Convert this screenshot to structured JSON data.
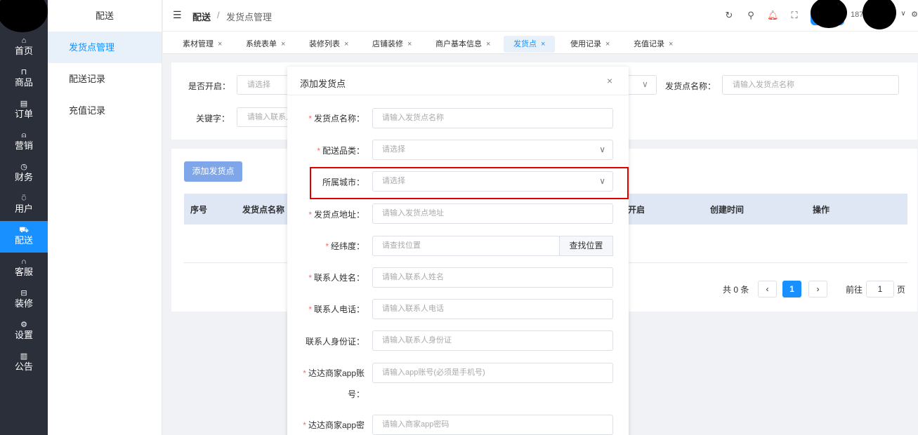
{
  "nav": {
    "items": [
      {
        "label": "首页",
        "icon": "home-icon",
        "glyph": "⌂"
      },
      {
        "label": "商品",
        "icon": "bag-icon",
        "glyph": "⊓"
      },
      {
        "label": "订单",
        "icon": "order-icon",
        "glyph": "▤"
      },
      {
        "label": "营销",
        "icon": "bell-icon",
        "glyph": "⍝"
      },
      {
        "label": "财务",
        "icon": "clock-icon",
        "glyph": "◷"
      },
      {
        "label": "用户",
        "icon": "user-icon",
        "glyph": "⍥"
      },
      {
        "label": "配送",
        "icon": "truck-icon",
        "glyph": "⛟"
      },
      {
        "label": "客服",
        "icon": "headset-icon",
        "glyph": "∩"
      },
      {
        "label": "装修",
        "icon": "brush-icon",
        "glyph": "⊟"
      },
      {
        "label": "设置",
        "icon": "gear-icon",
        "glyph": "⚙"
      },
      {
        "label": "公告",
        "icon": "notice-icon",
        "glyph": "▥"
      }
    ],
    "active_index": 6
  },
  "subnav": {
    "title": "配送",
    "items": [
      "发货点管理",
      "配送记录",
      "充值记录"
    ]
  },
  "header": {
    "breadcrumb_root": "配送",
    "breadcrumb_sep": "/",
    "breadcrumb_current": "发货点管理",
    "username": "187"
  },
  "tabs": [
    {
      "label": "素材管理"
    },
    {
      "label": "系统表单"
    },
    {
      "label": "装修列表"
    },
    {
      "label": "店铺装修"
    },
    {
      "label": "商户基本信息"
    },
    {
      "label": "发货点"
    },
    {
      "label": "使用记录"
    },
    {
      "label": "充值记录"
    }
  ],
  "filters": {
    "enabled_label": "是否开启：",
    "enabled_placeholder": "请选择",
    "name_label": "发货点名称：",
    "name_placeholder": "请输入发货点名称",
    "keyword_label": "关键字：",
    "keyword_placeholder": "请输入联系人"
  },
  "table": {
    "add_button": "添加发货点",
    "columns": [
      "序号",
      "发货点名称",
      "开启",
      "创建时间",
      "操作"
    ]
  },
  "pagination": {
    "total_text": "共 0 条",
    "current_page": "1",
    "goto_label": "前往",
    "goto_value": "1",
    "page_suffix": "页"
  },
  "dialog": {
    "title": "添加发货点",
    "fields": [
      {
        "label": "发货点名称：",
        "required": true,
        "placeholder": "请输入发货点名称"
      },
      {
        "label": "配送品类：",
        "required": true,
        "placeholder": "请选择",
        "select": true
      },
      {
        "label": "所属城市：",
        "required": false,
        "placeholder": "请选择",
        "select": true
      },
      {
        "label": "发货点地址：",
        "required": true,
        "placeholder": "请输入发货点地址"
      },
      {
        "label": "经纬度：",
        "required": true,
        "placeholder": "请查找位置"
      },
      {
        "label": "联系人姓名：",
        "required": true,
        "placeholder": "请输入联系人姓名"
      },
      {
        "label": "联系人电话：",
        "required": true,
        "placeholder": "请输入联系人电话"
      },
      {
        "label": "联系人身份证：",
        "required": false,
        "placeholder": "请输入联系人身份证"
      },
      {
        "label": "达达商家app账",
        "label2": "号：",
        "required": true,
        "placeholder": "请输入app账号(必须是手机号)"
      },
      {
        "label": "达达商家app密",
        "required": true,
        "placeholder": "请输入商家app密码"
      }
    ],
    "search_button": "查找位置"
  },
  "colors": {
    "accent": "#1890ff",
    "nav_bg": "#2b2f3a",
    "highlight_border": "#e00000",
    "required": "#f56c6c"
  }
}
